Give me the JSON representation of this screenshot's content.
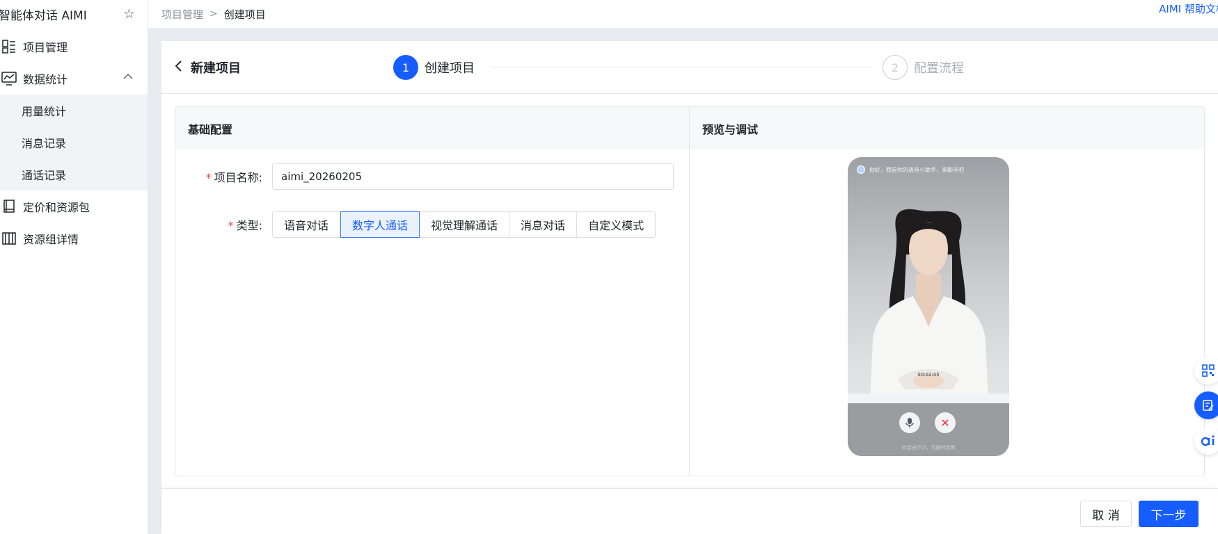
{
  "app": {
    "title": "智能体对话 AIMI"
  },
  "sidebar": {
    "items": [
      {
        "label": "项目管理",
        "icon": "project-icon"
      },
      {
        "label": "数据统计",
        "icon": "chart-icon",
        "expanded": true,
        "children": [
          {
            "label": "用量统计"
          },
          {
            "label": "消息记录"
          },
          {
            "label": "通话记录"
          }
        ]
      },
      {
        "label": "定价和资源包",
        "icon": "pricing-icon"
      },
      {
        "label": "资源组详情",
        "icon": "resource-group-icon"
      }
    ]
  },
  "breadcrumb": {
    "parent": "项目管理",
    "separator": ">",
    "current": "创建项目"
  },
  "help_link": "AIMI 帮助文档",
  "page": {
    "back_title": "新建项目",
    "steps": [
      {
        "number": "1",
        "label": "创建项目",
        "state": "active"
      },
      {
        "number": "2",
        "label": "配置流程",
        "state": "inactive"
      }
    ]
  },
  "config": {
    "title": "基础配置",
    "name_label": "项目名称:",
    "name_value": "aimi_20260205",
    "type_label": "类型:",
    "type_options": [
      "语音对话",
      "数字人通话",
      "视觉理解通话",
      "消息对话",
      "自定义模式"
    ],
    "type_selected": "数字人通话"
  },
  "preview": {
    "title": "预览与调试",
    "greeting": "你好，我是你的语音小助手，来聊天吧",
    "timer": "00:02:45",
    "note": "对话进行中，可随时挂断"
  },
  "footer": {
    "cancel": "取 消",
    "next": "下一步"
  },
  "colors": {
    "primary": "#165dff",
    "required": "#f53f3f",
    "sidebar_active_bg": "#f2f3f5"
  }
}
